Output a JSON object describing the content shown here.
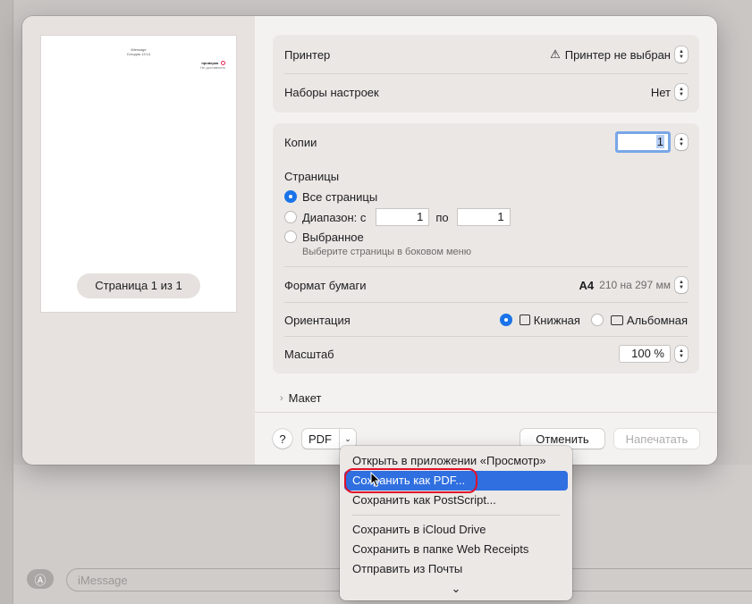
{
  "background": {
    "imessage_placeholder": "iMessage",
    "app_store_icon": "app-store-icon"
  },
  "preview": {
    "thumb_header_line1": "iMessage",
    "thumb_header_line2": "Сегодня 13:14",
    "thumb_message": "проверка",
    "thumb_message_sub": "Не доставлено",
    "page_indicator": "Страница 1 из 1"
  },
  "printer_group": {
    "printer_label": "Принтер",
    "printer_value": "Принтер не выбран",
    "presets_label": "Наборы настроек",
    "presets_value": "Нет"
  },
  "copies": {
    "label": "Копии",
    "value": "1"
  },
  "pages": {
    "label": "Страницы",
    "all_label": "Все страницы",
    "range_label": "Диапазон: с",
    "range_from": "1",
    "range_to_label": "по",
    "range_to": "1",
    "selected_label": "Выбранное",
    "selected_hint": "Выберите страницы в боковом меню"
  },
  "paper": {
    "label": "Формат бумаги",
    "value": "A4",
    "size": "210 на 297 мм"
  },
  "orientation": {
    "label": "Ориентация",
    "portrait": "Книжная",
    "landscape": "Альбомная"
  },
  "scale": {
    "label": "Масштаб",
    "value": "100 %"
  },
  "layout_section": {
    "label": "Макет"
  },
  "footer": {
    "help": "?",
    "pdf": "PDF",
    "cancel": "Отменить",
    "print": "Напечатать"
  },
  "pdf_menu": {
    "items": [
      "Открыть в приложении «Просмотр»",
      "Сохранить как PDF...",
      "Сохранить как PostScript...",
      "Сохранить в iCloud Drive",
      "Сохранить в папке Web Receipts",
      "Отправить из Почты"
    ]
  },
  "colors": {
    "accent": "#1a73e8",
    "menu_highlight": "#2f6fe0",
    "annotation": "#e0112b"
  }
}
